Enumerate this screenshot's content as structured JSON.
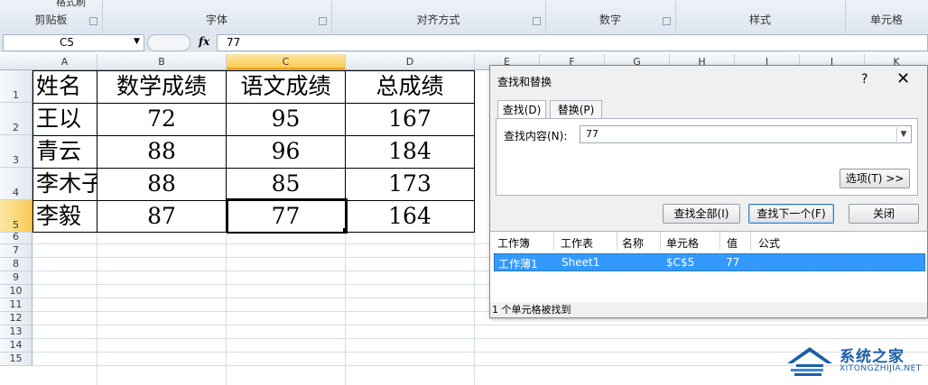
{
  "ribbon": {
    "groups": [
      "剪贴板",
      "字体",
      "对齐方式",
      "数字",
      "样式",
      "单元格"
    ],
    "top_partial": "格式刷"
  },
  "formula_bar": {
    "name_box": "C5",
    "fx": "fx",
    "value": "77"
  },
  "sheet": {
    "columns": [
      "A",
      "B",
      "C",
      "D",
      "E",
      "F",
      "G",
      "H",
      "I",
      "J",
      "K"
    ],
    "rows": [
      "1",
      "2",
      "3",
      "4",
      "5",
      "6",
      "7",
      "8",
      "9",
      "10",
      "11",
      "12",
      "13",
      "14",
      "15"
    ],
    "selected_column": "C",
    "selected_row": "5",
    "table": [
      [
        "姓名",
        "数学成绩",
        "语文成绩",
        "总成绩"
      ],
      [
        "王以",
        "72",
        "95",
        "167"
      ],
      [
        "青云",
        "88",
        "96",
        "184"
      ],
      [
        "李木子",
        "88",
        "85",
        "173"
      ],
      [
        "李毅",
        "87",
        "77",
        "164"
      ]
    ]
  },
  "dialog": {
    "title": "查找和替换",
    "help": "?",
    "close": "✕",
    "tabs": [
      "查找(D)",
      "替换(P)"
    ],
    "find_label": "查找内容(N):",
    "find_value": "77",
    "options_button": "选项(T) >>",
    "find_all_button": "查找全部(I)",
    "find_next_button": "查找下一个(F)",
    "close_button": "关闭",
    "result_headers": [
      "工作簿",
      "工作表",
      "名称",
      "单元格",
      "值",
      "公式"
    ],
    "result_row": {
      "workbook": "工作薄1",
      "sheet": "Sheet1",
      "name": "",
      "cell": "$C$5",
      "value": "77",
      "formula": ""
    },
    "status": "1 个单元格被找到"
  },
  "watermark": {
    "text": "系统之家",
    "sub": "XITONGZHIJIA.NET"
  },
  "colors": {
    "selection_header": "#f9cb55",
    "result_highlight": "#3399ff",
    "watermark": "#1d5fa8"
  }
}
